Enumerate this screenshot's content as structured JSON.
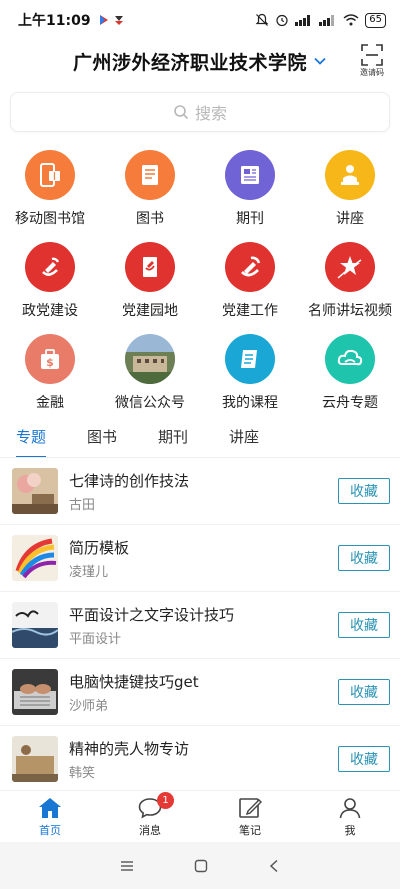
{
  "status_bar": {
    "time": "上午11:09",
    "battery": "65"
  },
  "header": {
    "title": "广州涉外经济职业技术学院",
    "scan_label": "邀请码"
  },
  "search": {
    "placeholder": "搜索"
  },
  "grid": [
    {
      "label": "移动图书馆",
      "icon": "mobile-library-icon",
      "color": "#f57c3a"
    },
    {
      "label": "图书",
      "icon": "book-icon",
      "color": "#f57c3a"
    },
    {
      "label": "期刊",
      "icon": "journal-icon",
      "color": "#6f63d6"
    },
    {
      "label": "讲座",
      "icon": "lecture-icon",
      "color": "#f7b718"
    },
    {
      "label": "政党建设",
      "icon": "party-building-icon",
      "color": "#e0322f"
    },
    {
      "label": "党建园地",
      "icon": "party-garden-icon",
      "color": "#e0322f"
    },
    {
      "label": "党建工作",
      "icon": "party-work-icon",
      "color": "#e0322f"
    },
    {
      "label": "名师讲坛视频",
      "icon": "master-video-icon",
      "color": "#e0322f"
    },
    {
      "label": "金融",
      "icon": "finance-icon",
      "color": "#e87c68"
    },
    {
      "label": "微信公众号",
      "icon": "wechat-official-icon",
      "color": "#7a8a6a"
    },
    {
      "label": "我的课程",
      "icon": "my-course-icon",
      "color": "#1aa7d6"
    },
    {
      "label": "云舟专题",
      "icon": "cloud-topic-icon",
      "color": "#1fc4ad"
    }
  ],
  "tabs": [
    {
      "label": "专题",
      "active": true
    },
    {
      "label": "图书",
      "active": false
    },
    {
      "label": "期刊",
      "active": false
    },
    {
      "label": "讲座",
      "active": false
    }
  ],
  "list": [
    {
      "title": "七律诗的创作技法",
      "subtitle": "古田",
      "button": "收藏"
    },
    {
      "title": "简历模板",
      "subtitle": "凌瑾儿",
      "button": "收藏"
    },
    {
      "title": "平面设计之文字设计技巧",
      "subtitle": "平面设计",
      "button": "收藏"
    },
    {
      "title": "电脑快捷键技巧get",
      "subtitle": "沙师弟",
      "button": "收藏"
    },
    {
      "title": "精神的壳人物专访",
      "subtitle": "韩笑",
      "button": "收藏"
    }
  ],
  "bottom_nav": [
    {
      "label": "首页",
      "icon": "home-icon",
      "active": true
    },
    {
      "label": "消息",
      "icon": "message-icon",
      "badge": "1"
    },
    {
      "label": "笔记",
      "icon": "note-icon"
    },
    {
      "label": "我",
      "icon": "profile-icon"
    }
  ],
  "colors": {
    "accent": "#1976d2",
    "favorite_border": "#2a93b3",
    "badge": "#e53935"
  }
}
